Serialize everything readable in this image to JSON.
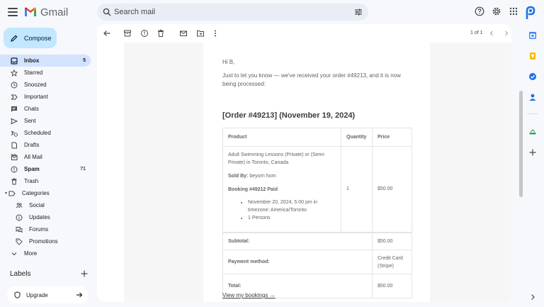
{
  "app": {
    "name": "Gmail"
  },
  "search": {
    "placeholder": "Search mail"
  },
  "compose": {
    "label": "Compose"
  },
  "nav": {
    "inbox": {
      "label": "Inbox",
      "count": "5"
    },
    "starred": {
      "label": "Starred"
    },
    "snoozed": {
      "label": "Snoozed"
    },
    "important": {
      "label": "Important"
    },
    "chats": {
      "label": "Chats"
    },
    "sent": {
      "label": "Sent"
    },
    "scheduled": {
      "label": "Scheduled"
    },
    "drafts": {
      "label": "Drafts"
    },
    "allmail": {
      "label": "All Mail"
    },
    "spam": {
      "label": "Spam",
      "count": "71"
    },
    "trash": {
      "label": "Trash"
    },
    "categories": {
      "label": "Categories"
    },
    "social": {
      "label": "Social"
    },
    "updates": {
      "label": "Updates"
    },
    "forums": {
      "label": "Forums"
    },
    "promotions": {
      "label": "Promotions"
    },
    "more": {
      "label": "More"
    }
  },
  "labels": {
    "header": "Labels"
  },
  "upgrade": {
    "label": "Upgrade"
  },
  "toolbar": {
    "pager": "1 of 1"
  },
  "email": {
    "greeting": "Hi B,",
    "intro": "Just to let you know — we've received your order #49213, and it is now being processed:",
    "heading": "[Order #49213] (November 19, 2024)",
    "table": {
      "headers": {
        "product": "Product",
        "quantity": "Quantity",
        "price": "Price"
      },
      "item": {
        "name": "Adult Swimming Lessons (Private) or (Semi-Private) in Toronto, Canada",
        "sold_by_label": "Sold By:",
        "sold_by": "beyorn horn",
        "booking": "Booking #49212 Paid",
        "detail_1": "November 20, 2024, 5:00 pm in timezone: America/Toronto",
        "detail_2": "1 Persons",
        "quantity": "1",
        "price": "$50.00"
      },
      "subtotal_label": "Subtotal:",
      "subtotal": "$50.00",
      "payment_label": "Payment method:",
      "payment": "Credit Card (Stripe)",
      "total_label": "Total:",
      "total": "$50.00"
    },
    "link": "View my bookings →"
  },
  "colors": {
    "accent": "#0b57d0",
    "compose_bg": "#c2e7ff",
    "active_nav": "#d3e3fd"
  }
}
